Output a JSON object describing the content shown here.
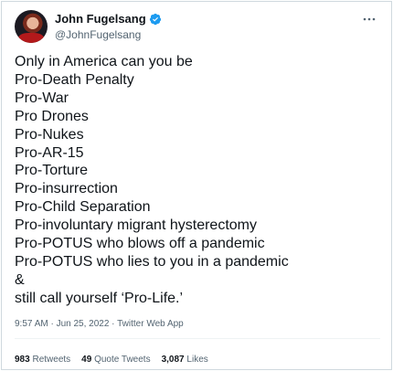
{
  "tweet": {
    "author": {
      "display_name": "John Fugelsang",
      "handle": "@JohnFugelsang",
      "verified": true
    },
    "lines": [
      "Only in America can you be",
      "Pro-Death Penalty",
      "Pro-War",
      "Pro Drones",
      "Pro-Nukes",
      "Pro-AR-15",
      "Pro-Torture",
      "Pro-insurrection",
      "Pro-Child Separation",
      "Pro-involuntary migrant hysterectomy",
      "Pro-POTUS who blows off a pandemic",
      "Pro-POTUS who lies to you in a pandemic",
      "&",
      "still call yourself ‘Pro-Life.’"
    ],
    "timestamp": "9:57 AM · Jun 25, 2022 · Twitter Web App",
    "stats": {
      "retweets_count": "983",
      "retweets_label": "Retweets",
      "quote_count": "49",
      "quote_label": "Quote Tweets",
      "likes_count": "3,087",
      "likes_label": "Likes"
    }
  },
  "colors": {
    "verified": "#1d9bf0",
    "text": "#0f1419",
    "secondary": "#536471",
    "border": "#cfd9de"
  },
  "icons": {
    "more": "more-horizontal-icon",
    "verified": "verified-badge-icon"
  }
}
